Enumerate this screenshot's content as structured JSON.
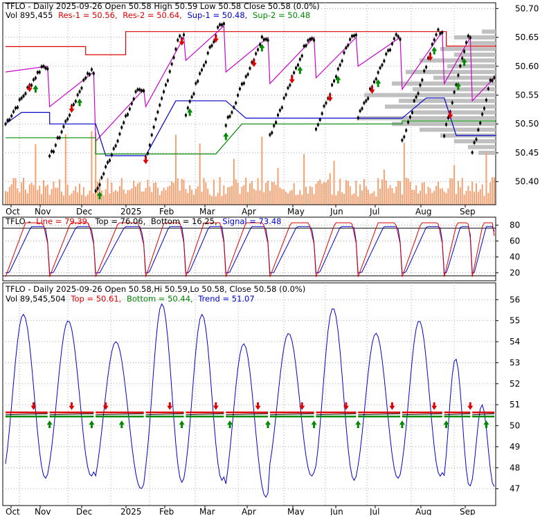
{
  "symbol": "TFLO",
  "colors": {
    "red": "#dd0000",
    "blue": "#0000cc",
    "green": "#008800",
    "magenta": "#cc00cc",
    "volume": "#f4a070",
    "grid": "#aaaaaa",
    "profile": "#c0c0c0"
  },
  "header": {
    "line1": "TFLO - Daily 2025-09-26 Open 50.58  High 50.59  Low 50.58  Close 50.58 (0.0%)",
    "vol_label": "Vol 895,455",
    "res1": "Res-1 = 50.56,",
    "res2": "Res-2 = 50.64,",
    "sup1": "Sup-1 = 50.48,",
    "sup2": "Sup-2 = 50.48"
  },
  "stoch_header": {
    "symbol": "TFLO -",
    "line": "Line = 79.39,",
    "top": "Top = 76.06,",
    "bottom": "Bottom = 16.25,",
    "signal": "Signal = 73.48"
  },
  "osc_header": {
    "line1": "TFLO - Daily 2025-09-26 Open 50.58,Hi 50.59,Lo 50.58, Close 50.58 (0.0%)",
    "vol": "Vol 89,545,504",
    "top": "Top = 50.61,",
    "bottom": "Bottom = 50.44,",
    "trend": "Trend = 51.07"
  },
  "chart_data": [
    {
      "type": "candlestick",
      "name": "price",
      "x_labels": [
        "Oct",
        "Nov",
        "Dec",
        "2025",
        "Feb",
        "Mar",
        "Apr",
        "May",
        "Jun",
        "Jul",
        "Aug",
        "Sep"
      ],
      "y_ticks": [
        "50.70",
        "50.65",
        "50.60",
        "50.55",
        "50.50",
        "50.45",
        "50.40"
      ],
      "ylim": [
        50.36,
        50.71
      ],
      "last_close": 50.58,
      "resistance": [
        50.56,
        50.64
      ],
      "support": [
        50.48,
        50.48
      ],
      "grid": true
    },
    {
      "type": "line",
      "name": "stochastic",
      "y_ticks": [
        "80",
        "60",
        "40",
        "20"
      ],
      "ylim": [
        10,
        90
      ],
      "line": 79.39,
      "top": 76.06,
      "bottom": 16.25,
      "signal": 73.48,
      "grid": true
    },
    {
      "type": "line",
      "name": "oscillator",
      "y_ticks": [
        "56",
        "55",
        "54",
        "53",
        "52",
        "51",
        "50",
        "49",
        "48",
        "47"
      ],
      "ylim": [
        46.2,
        56.8
      ],
      "top": 50.61,
      "bottom": 50.44,
      "trend": 51.07,
      "grid": true
    }
  ]
}
